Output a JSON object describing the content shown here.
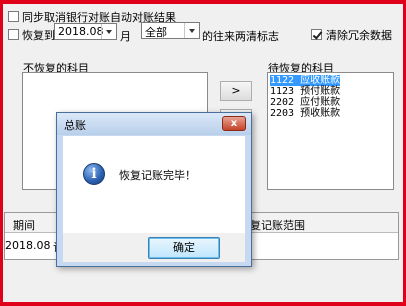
{
  "options": {
    "cancel_reconcile_label": "同步取消银行对账自动对账结果",
    "restore_to_label": "恢复到",
    "period_value": "2018.08",
    "month_suffix": "月",
    "scope_value": "全部",
    "scope_suffix": "的往来两清标志",
    "clear_redundant_label": "清除冗余数据",
    "clear_redundant_checked": true
  },
  "lists": {
    "left_title": "不恢复的科目",
    "right_title": "待恢复的科目",
    "right_items": [
      {
        "code": "1122",
        "name": "应收账款",
        "selected": true
      },
      {
        "code": "1123",
        "name": "预付账款",
        "selected": false
      },
      {
        "code": "2202",
        "name": "应付账款",
        "selected": false
      },
      {
        "code": "2203",
        "name": "预收账款",
        "selected": false
      }
    ]
  },
  "buttons": {
    "move_right": ">",
    "move_all_right": ">>",
    "move_left": "<",
    "move_all_left": "<<"
  },
  "grid": {
    "col_period": "期间",
    "col_range": "恢复记账范围",
    "row_period": "2018.08",
    "row_partial": "记"
  },
  "dialog": {
    "title": "总账",
    "close_glyph": "x",
    "icon_glyph": "i",
    "message": "恢复记账完毕！",
    "ok_label": "确定"
  }
}
